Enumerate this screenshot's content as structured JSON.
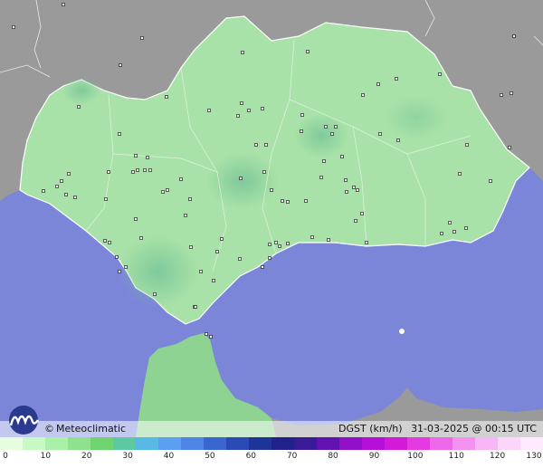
{
  "map": {
    "credit": "Meteoclimatic",
    "credit_symbol": "©",
    "variable": "DGST (km/h)",
    "timestamp": "31-03-2025 @ 00:15 UTC",
    "colors": {
      "sea": "#7b86d9",
      "land_outside": "#9a9a9a",
      "region_fill": "#a9e2a8",
      "region_fill_dark": "#8fd392",
      "border": "#ffffff"
    }
  },
  "legend": {
    "ticks": [
      "0",
      "10",
      "20",
      "30",
      "40",
      "50",
      "60",
      "70",
      "80",
      "90",
      "100",
      "110",
      "120",
      "130"
    ],
    "colors": [
      "#e8fde0",
      "#c8f8c4",
      "#a9f0a8",
      "#8ee28e",
      "#6fd46f",
      "#5dc9a0",
      "#58b8e6",
      "#5a9ff0",
      "#4f85e6",
      "#3a66cf",
      "#2a4bb5",
      "#1f3497",
      "#20228a",
      "#3a1a96",
      "#6212b0",
      "#9010c8",
      "#b610d8",
      "#d21ad8",
      "#e43ae0",
      "#ee68ea",
      "#f490f0",
      "#f8b6f6",
      "#fbd6fa",
      "#fdeafd"
    ]
  }
}
